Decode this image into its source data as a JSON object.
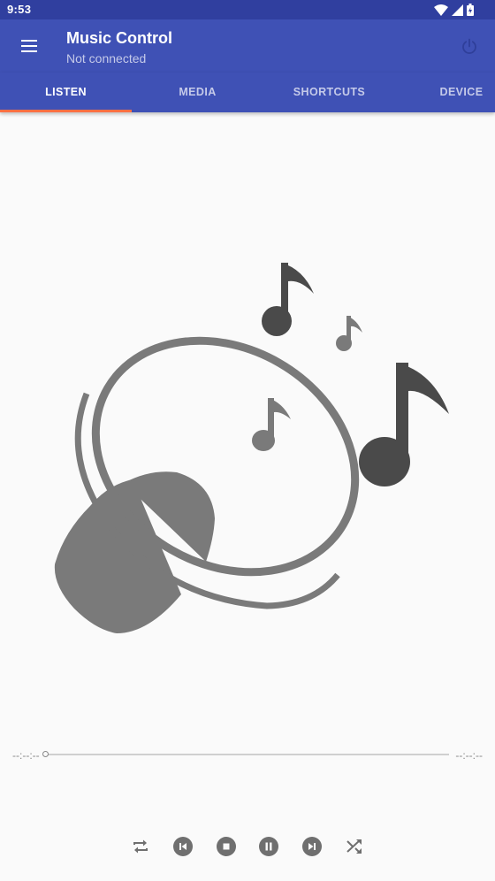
{
  "status_bar": {
    "time": "9:53"
  },
  "app_bar": {
    "title": "Music Control",
    "subtitle": "Not connected"
  },
  "tabs": [
    {
      "label": "LISTEN",
      "active": true
    },
    {
      "label": "MEDIA",
      "active": false
    },
    {
      "label": "SHORTCUTS",
      "active": false
    },
    {
      "label": "DEVICE",
      "active": false
    }
  ],
  "player": {
    "elapsed": "--:--:--",
    "remaining": "--:--:--",
    "progress": 0
  },
  "controls": [
    "repeat-icon",
    "skip-previous-icon",
    "stop-icon",
    "pause-icon",
    "skip-next-icon",
    "shuffle-icon"
  ],
  "colors": {
    "primary": "#3f51b5",
    "primary_dark": "#303f9f",
    "accent": "#ff7043",
    "illustration": "#7a7a7a"
  }
}
